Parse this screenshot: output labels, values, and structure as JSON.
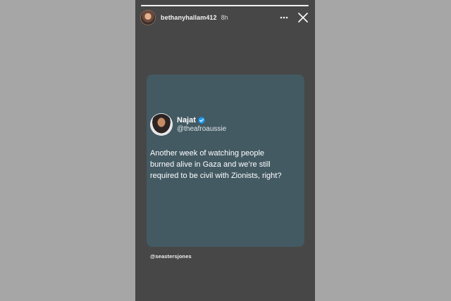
{
  "story": {
    "progress_fraction": 1.0,
    "username": "bethanyhallam412",
    "timestamp": "8h",
    "icons": {
      "avatar": "avatar",
      "more": "more-horizontal-icon",
      "close": "close-icon"
    },
    "mention": "@seastersjones"
  },
  "tweet": {
    "display_name": "Najat",
    "handle": "@theafroaussie",
    "text_lines": [
      "Another week of watching people",
      "burned alive in Gaza and we’re still",
      "required to be civil with Zionists, right?"
    ],
    "verified_icon": "verified-badge-icon",
    "colors": {
      "card_background": "#435a63",
      "verified": "#1d9bf0"
    }
  },
  "colors": {
    "page_background": "#a6a6a6",
    "story_background": "#474747"
  }
}
